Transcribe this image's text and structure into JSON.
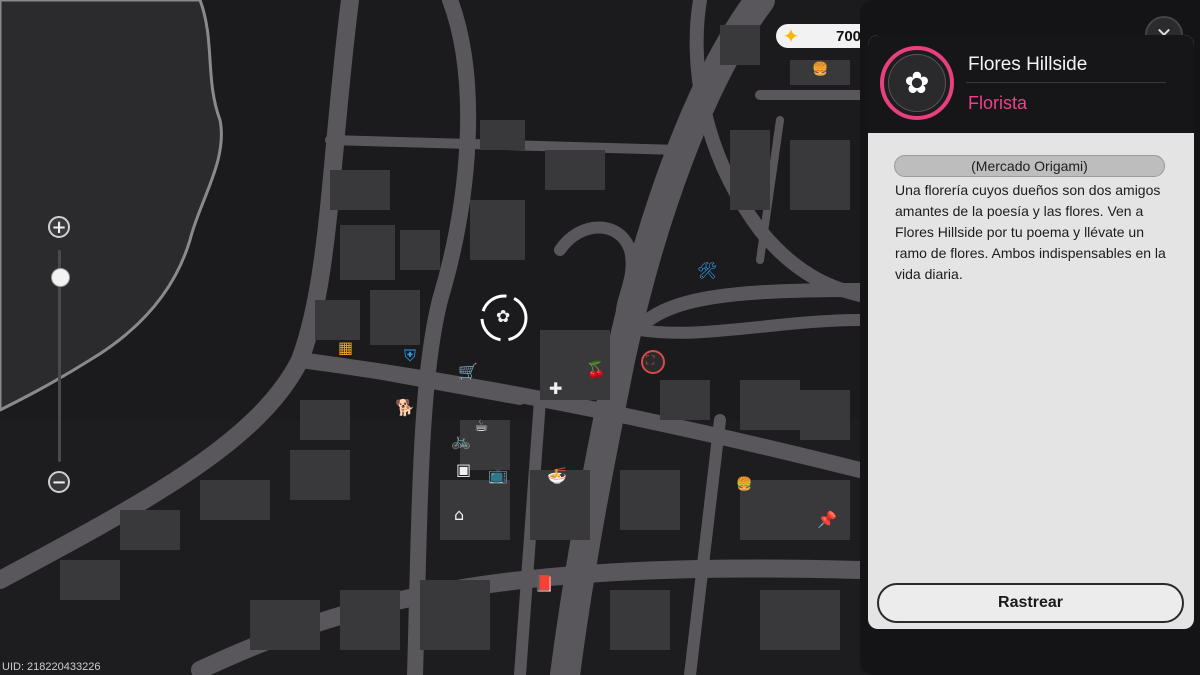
{
  "currency": {
    "icon": "polychrome-gem-icon",
    "amount": "700"
  },
  "detail": {
    "name": "Flores Hillside",
    "category": "Florista",
    "category_color": "#e8407f",
    "location": "(Mercado Origami)",
    "description": "Una florería cuyos dueños son dos amigos amantes de la poesía y las flores. Ven a Flores Hillside por tu poema y llévate un ramo de flores. Ambos indispensables en la vida diaria.",
    "track_label": "Rastrear",
    "close_icon": "close-icon"
  },
  "zoom": {
    "plus": "+",
    "minus": "−",
    "level": 0.1
  },
  "footer": {
    "uid": "UID: 218220433226"
  },
  "pois": [
    {
      "name": "flower-shop-icon",
      "glyph": "✿"
    },
    {
      "name": "burger-icon",
      "glyph": "🍔"
    },
    {
      "name": "shopping-cart-icon",
      "glyph": "🛒"
    },
    {
      "name": "first-aid-icon",
      "glyph": "✚"
    },
    {
      "name": "dog-icon",
      "glyph": "🐕"
    },
    {
      "name": "bicycle-icon",
      "glyph": "🚲"
    },
    {
      "name": "coffee-icon",
      "glyph": "☕"
    },
    {
      "name": "washing-machine-icon",
      "glyph": "▣"
    },
    {
      "name": "tv-icon",
      "glyph": "📺"
    },
    {
      "name": "bowl-icon",
      "glyph": "🍜"
    },
    {
      "name": "store-icon",
      "glyph": "⌂"
    },
    {
      "name": "book-icon",
      "glyph": "📕"
    },
    {
      "name": "pin-icon",
      "glyph": "📌"
    },
    {
      "name": "cherries-icon",
      "glyph": "🍒"
    },
    {
      "name": "building-icon",
      "glyph": "▦"
    },
    {
      "name": "shield-icon",
      "glyph": "⛨"
    },
    {
      "name": "tools-icon",
      "glyph": "🛠"
    },
    {
      "name": "transit-icon",
      "glyph": "⛶"
    }
  ]
}
